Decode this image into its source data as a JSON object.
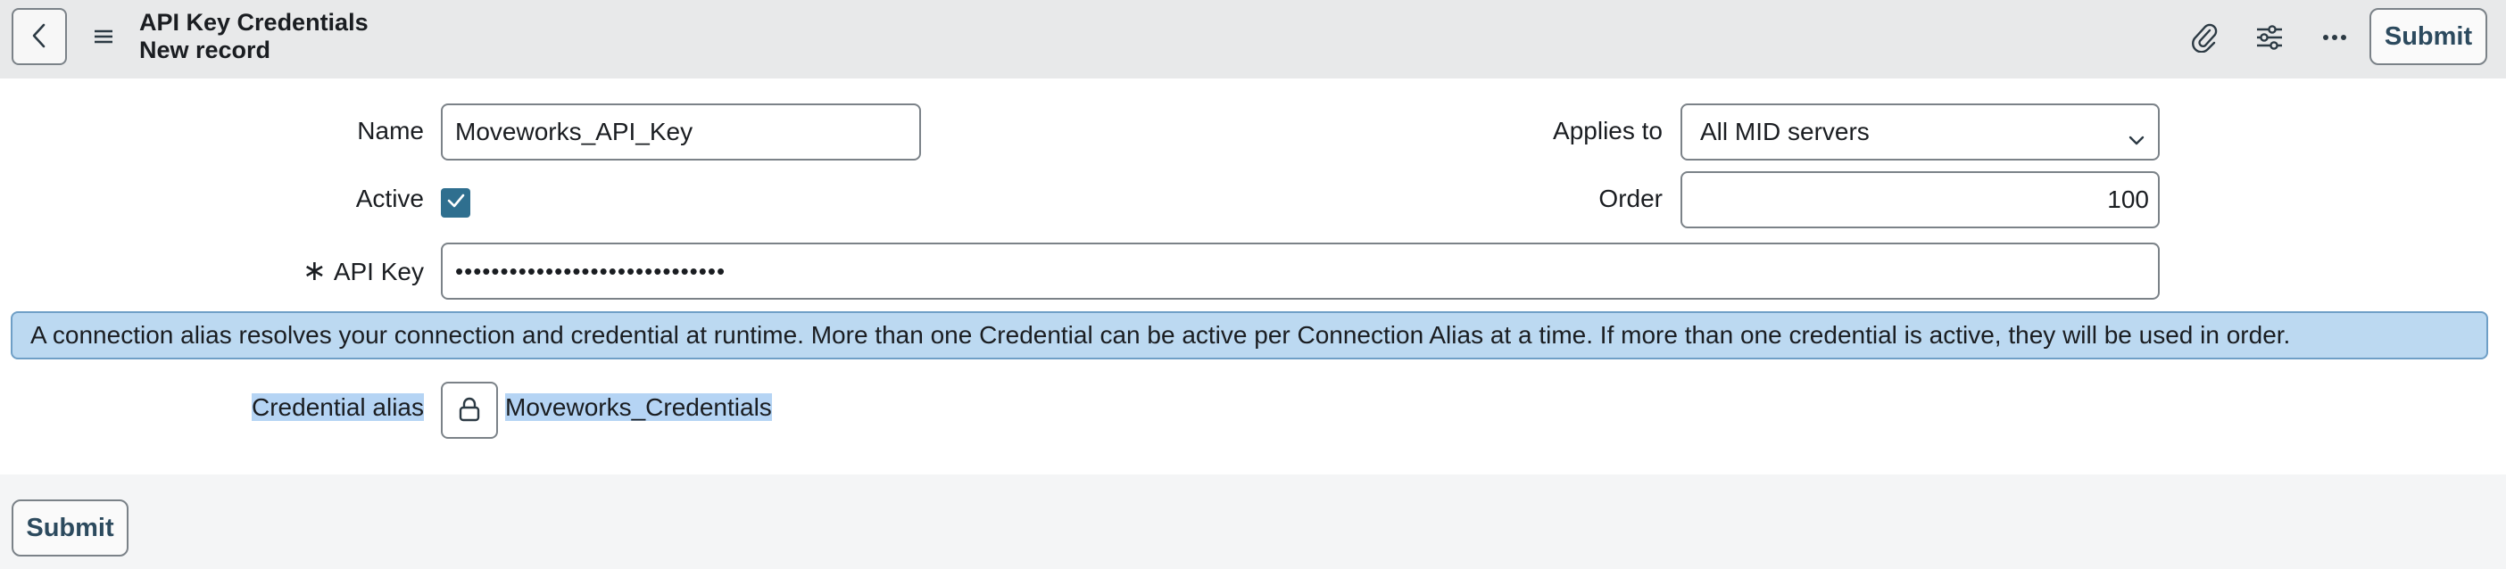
{
  "header": {
    "title": "API Key Credentials",
    "subtitle": "New record",
    "submit_label": "Submit",
    "icons": [
      "chevron-left-icon",
      "hamburger-menu-icon",
      "paperclip-icon",
      "sliders-icon",
      "more-horizontal-icon"
    ]
  },
  "form": {
    "name": {
      "label": "Name",
      "value": "Moveworks_API_Key"
    },
    "applies_to": {
      "label": "Applies to",
      "value": "All MID servers"
    },
    "active": {
      "label": "Active",
      "checked": true
    },
    "order": {
      "label": "Order",
      "value": "100"
    },
    "api_key": {
      "required_marker": "∗",
      "label": "API Key",
      "masked_value": "••••••••••••••••••••••••••••••"
    },
    "info_message": "A connection alias resolves your connection and credential at runtime. More than one Credential can be active per Connection Alias at a time. If more than one credential is active, they will be used in order.",
    "credential_alias": {
      "label": "Credential alias",
      "value": "Moveworks_Credentials"
    }
  },
  "footer": {
    "submit_label": "Submit"
  },
  "colors": {
    "header_bg": "#e8e9ea",
    "accent": "#2f6f8f",
    "info_bg": "#bcd9f1",
    "button_text": "#2c4a5e"
  }
}
